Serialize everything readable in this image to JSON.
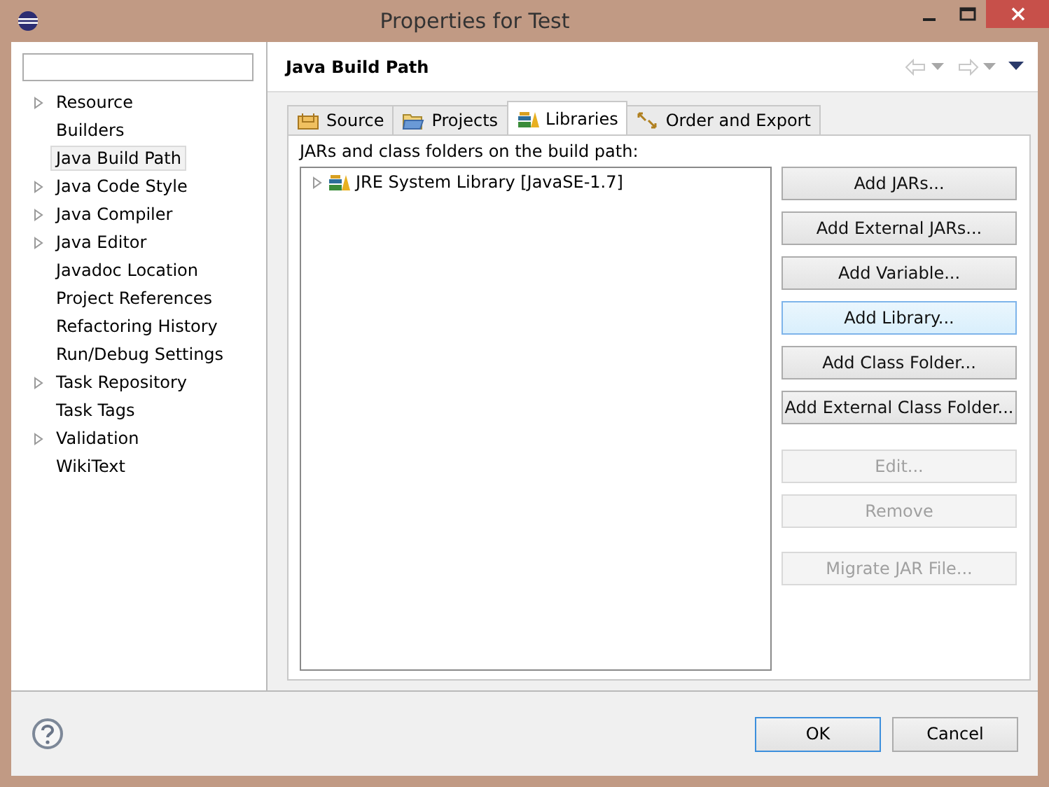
{
  "window": {
    "title": "Properties for Test"
  },
  "sidebar": {
    "items": [
      {
        "label": "Resource",
        "expandable": true,
        "selected": false
      },
      {
        "label": "Builders",
        "expandable": false,
        "selected": false
      },
      {
        "label": "Java Build Path",
        "expandable": false,
        "selected": true
      },
      {
        "label": "Java Code Style",
        "expandable": true,
        "selected": false
      },
      {
        "label": "Java Compiler",
        "expandable": true,
        "selected": false
      },
      {
        "label": "Java Editor",
        "expandable": true,
        "selected": false
      },
      {
        "label": "Javadoc Location",
        "expandable": false,
        "selected": false
      },
      {
        "label": "Project References",
        "expandable": false,
        "selected": false
      },
      {
        "label": "Refactoring History",
        "expandable": false,
        "selected": false
      },
      {
        "label": "Run/Debug Settings",
        "expandable": false,
        "selected": false
      },
      {
        "label": "Task Repository",
        "expandable": true,
        "selected": false
      },
      {
        "label": "Task Tags",
        "expandable": false,
        "selected": false
      },
      {
        "label": "Validation",
        "expandable": true,
        "selected": false
      },
      {
        "label": "WikiText",
        "expandable": false,
        "selected": false
      }
    ]
  },
  "page": {
    "title": "Java Build Path",
    "tabs": [
      {
        "label": "Source",
        "selected": false
      },
      {
        "label": "Projects",
        "selected": false
      },
      {
        "label": "Libraries",
        "selected": true
      },
      {
        "label": "Order and Export",
        "selected": false
      }
    ],
    "list_label": "JARs and class folders on the build path:",
    "tree": [
      {
        "label": "JRE System Library [JavaSE-1.7]",
        "expandable": true
      }
    ],
    "buttons": [
      {
        "label": "Add JARs...",
        "disabled": false,
        "highlighted": false
      },
      {
        "label": "Add External JARs...",
        "disabled": false,
        "highlighted": false
      },
      {
        "label": "Add Variable...",
        "disabled": false,
        "highlighted": false
      },
      {
        "label": "Add Library...",
        "disabled": false,
        "highlighted": true
      },
      {
        "label": "Add Class Folder...",
        "disabled": false,
        "highlighted": false
      },
      {
        "label": "Add External Class Folder...",
        "disabled": false,
        "highlighted": false
      },
      {
        "label": "Edit...",
        "disabled": true,
        "highlighted": false
      },
      {
        "label": "Remove",
        "disabled": true,
        "highlighted": false
      },
      {
        "label": "Migrate JAR File...",
        "disabled": true,
        "highlighted": false
      }
    ]
  },
  "footer": {
    "buttons": [
      {
        "label": "OK",
        "default": true
      },
      {
        "label": "Cancel",
        "default": false
      }
    ]
  }
}
